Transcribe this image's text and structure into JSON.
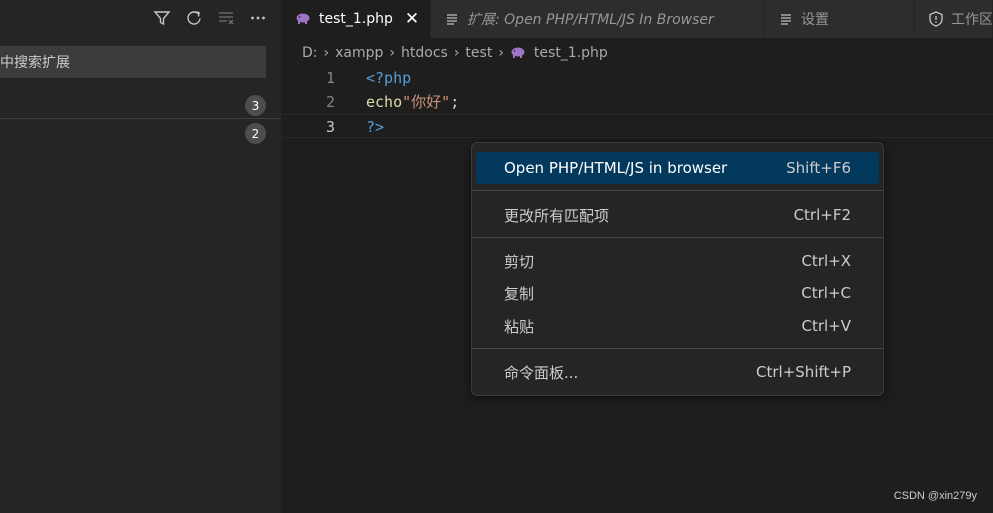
{
  "sidebar": {
    "search_placeholder": "中搜索扩展",
    "results": [
      {
        "count": "3"
      },
      {
        "count": "2"
      }
    ],
    "toolbar_icons": [
      "filter-icon",
      "refresh-icon",
      "clear-results-icon",
      "more-actions-icon"
    ]
  },
  "tabs": [
    {
      "label": "test_1.php",
      "icon": "php-elephant-icon",
      "active": true
    },
    {
      "label": "扩展: Open PHP/HTML/JS In Browser",
      "icon": "preview-icon",
      "active": false
    },
    {
      "label": "设置",
      "icon": "preview-icon",
      "active": false
    },
    {
      "label": "工作区",
      "icon": "shield-icon",
      "active": false
    }
  ],
  "breadcrumb": {
    "items": [
      "D:",
      "xampp",
      "htdocs",
      "test",
      "test_1.php"
    ]
  },
  "editor": {
    "lines": [
      {
        "num": "1",
        "parts": [
          "<?php"
        ]
      },
      {
        "num": "2",
        "parts": [
          "echo",
          "\"你好\"",
          ";"
        ]
      },
      {
        "num": "3",
        "parts": [
          "?>"
        ]
      }
    ]
  },
  "context_menu": {
    "items": [
      {
        "label": "Open PHP/HTML/JS in browser",
        "shortcut": "Shift+F6"
      },
      {
        "label": "更改所有匹配项",
        "shortcut": "Ctrl+F2"
      },
      {
        "label": "剪切",
        "shortcut": "Ctrl+X"
      },
      {
        "label": "复制",
        "shortcut": "Ctrl+C"
      },
      {
        "label": "粘贴",
        "shortcut": "Ctrl+V"
      },
      {
        "label": "命令面板...",
        "shortcut": "Ctrl+Shift+P"
      }
    ]
  },
  "watermark": "CSDN @xin279y",
  "colors": {
    "accent": "#04395e",
    "tag": "#569cd6",
    "function": "#dcdcaa",
    "string": "#ce9178"
  }
}
